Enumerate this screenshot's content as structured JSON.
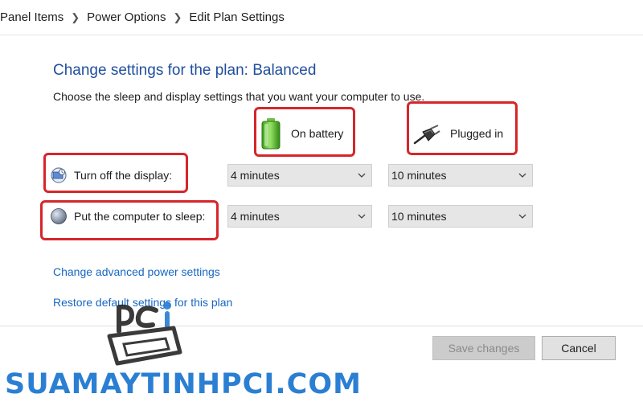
{
  "breadcrumb": {
    "items": [
      "Panel Items",
      "Power Options",
      "Edit Plan Settings"
    ]
  },
  "page": {
    "title": "Change settings for the plan: Balanced",
    "subtitle": "Choose the sleep and display settings that you want your computer to use."
  },
  "columns": {
    "battery": {
      "label": "On battery",
      "icon": "battery-icon"
    },
    "plugged": {
      "label": "Plugged in",
      "icon": "power-plug-icon"
    }
  },
  "settings": {
    "display": {
      "label": "Turn off the display:",
      "icon": "display-icon",
      "battery_value": "4 minutes",
      "plugged_value": "10 minutes"
    },
    "sleep": {
      "label": "Put the computer to sleep:",
      "icon": "sleep-moon-icon",
      "battery_value": "4 minutes",
      "plugged_value": "10 minutes"
    }
  },
  "links": {
    "advanced": "Change advanced power settings",
    "restore": "Restore default settings for this plan"
  },
  "buttons": {
    "save": "Save changes",
    "cancel": "Cancel"
  },
  "watermark": {
    "text": "SUAMAYTINHPCI.COM"
  },
  "colors": {
    "title_blue": "#1f4e9d",
    "link_blue": "#1767c2",
    "highlight_red": "#d6262a",
    "watermark_blue": "#2b7fd3"
  }
}
